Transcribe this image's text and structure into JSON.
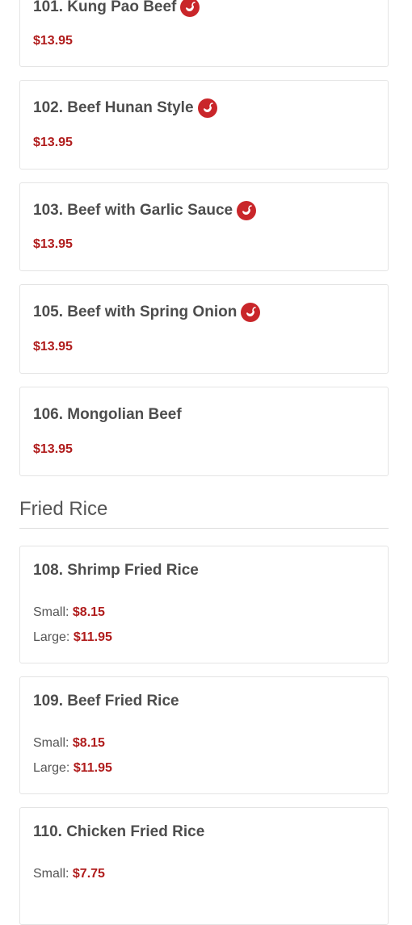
{
  "colors": {
    "price": "#b01c1c",
    "spicy_icon": "#c9262a",
    "card_border": "#e4e4e4",
    "title_text": "#4d4d4d"
  },
  "icons": {
    "spicy": "chili-pepper-icon"
  },
  "beef_items": [
    {
      "name": "101. Kung Pao Beef",
      "price": "$13.95",
      "spicy": true
    },
    {
      "name": "102. Beef Hunan Style",
      "price": "$13.95",
      "spicy": true
    },
    {
      "name": "103. Beef with Garlic Sauce",
      "price": "$13.95",
      "spicy": true
    },
    {
      "name": "105. Beef with Spring Onion",
      "price": "$13.95",
      "spicy": true
    },
    {
      "name": "106. Mongolian Beef",
      "price": "$13.95",
      "spicy": false
    }
  ],
  "fried_rice": {
    "heading": "Fried Rice",
    "items": [
      {
        "name": "108. Shrimp Fried Rice",
        "sizes": [
          {
            "label": "Small:",
            "price": "$8.15"
          },
          {
            "label": "Large:",
            "price": "$11.95"
          }
        ]
      },
      {
        "name": "109. Beef Fried Rice",
        "sizes": [
          {
            "label": "Small:",
            "price": "$8.15"
          },
          {
            "label": "Large:",
            "price": "$11.95"
          }
        ]
      },
      {
        "name": "110. Chicken Fried Rice",
        "sizes": [
          {
            "label": "Small:",
            "price": "$7.75"
          }
        ]
      }
    ]
  }
}
